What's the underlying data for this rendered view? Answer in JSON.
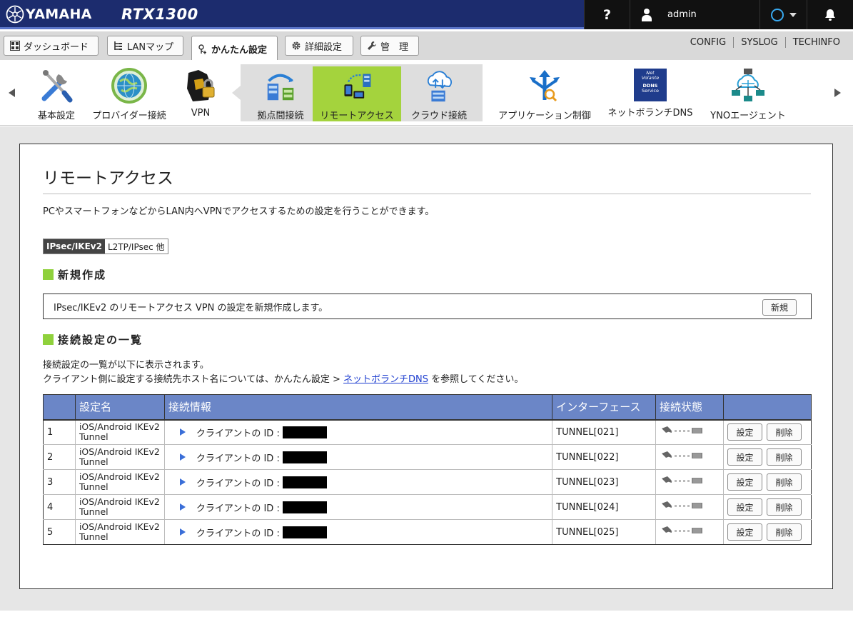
{
  "header": {
    "brand": "YAMAHA",
    "model": "RTX1300",
    "help_label": "?",
    "user_name": "admin"
  },
  "tabs": [
    {
      "label": "ダッシュボード",
      "icon": "dashboard-icon"
    },
    {
      "label": "LANマップ",
      "icon": "lan-map-icon"
    },
    {
      "label": "かんたん設定",
      "icon": "wand-icon",
      "active": true
    },
    {
      "label": "詳細設定",
      "icon": "gear-icon"
    },
    {
      "label": "管　理",
      "icon": "wrench-icon"
    }
  ],
  "toplinks": [
    "CONFIG",
    "SYSLOG",
    "TECHINFO"
  ],
  "nav": {
    "items": [
      {
        "label": "基本設定",
        "icon": "tools-icon"
      },
      {
        "label": "プロバイダー接続",
        "icon": "globe-icon"
      },
      {
        "label": "VPN",
        "icon": "padlock-icon"
      },
      {
        "label": "拠点間接続",
        "icon": "site-to-site-icon"
      },
      {
        "label": "リモートアクセス",
        "icon": "remote-access-icon",
        "selected": true
      },
      {
        "label": "クラウド接続",
        "icon": "cloud-icon"
      },
      {
        "label": "アプリケーション制御",
        "icon": "app-control-icon"
      },
      {
        "label": "ネットボランチDNS",
        "icon": "ddns-icon",
        "badge": [
          "Net",
          "Volante",
          "DDNS",
          "Service"
        ]
      },
      {
        "label": "YNOエージェント",
        "icon": "yno-agent-icon"
      }
    ]
  },
  "page": {
    "title": "リモートアクセス",
    "description": "PCやスマートフォンなどからLAN内へVPNでアクセスするための設定を行うことができます。",
    "subtabs": [
      "IPsec/IKEv2",
      "L2TP/IPsec 他"
    ],
    "new_section": {
      "heading": "新規作成",
      "text": "IPsec/IKEv2 のリモートアクセス VPN の設定を新規作成します。",
      "button": "新規"
    },
    "list_section": {
      "heading": "接続設定の一覧",
      "desc_line1": "接続設定の一覧が以下に表示されます。",
      "desc_line2_pre": "クライアント側に設定する接続先ホスト名については、かんたん設定 > ",
      "desc_link": "ネットボランチDNS",
      "desc_line2_post": " を参照してください。"
    },
    "table": {
      "headers": [
        "",
        "設定名",
        "接続情報",
        "インターフェース",
        "接続状態",
        ""
      ],
      "rows": [
        {
          "no": "1",
          "name_line1": "iOS/Android IKEv2",
          "name_line2": "Tunnel",
          "info": "クライアントの ID :",
          "iface": "TUNNEL[021]"
        },
        {
          "no": "2",
          "name_line1": "iOS/Android IKEv2",
          "name_line2": "Tunnel",
          "info": "クライアントの ID :",
          "iface": "TUNNEL[022]"
        },
        {
          "no": "3",
          "name_line1": "iOS/Android IKEv2",
          "name_line2": "Tunnel",
          "info": "クライアントの ID :",
          "iface": "TUNNEL[023]"
        },
        {
          "no": "4",
          "name_line1": "iOS/Android IKEv2",
          "name_line2": "Tunnel",
          "info": "クライアントの ID :",
          "iface": "TUNNEL[024]"
        },
        {
          "no": "5",
          "name_line1": "iOS/Android IKEv2",
          "name_line2": "Tunnel",
          "info": "クライアントの ID :",
          "iface": "TUNNEL[025]"
        }
      ],
      "edit_label": "設定",
      "delete_label": "削除"
    }
  }
}
